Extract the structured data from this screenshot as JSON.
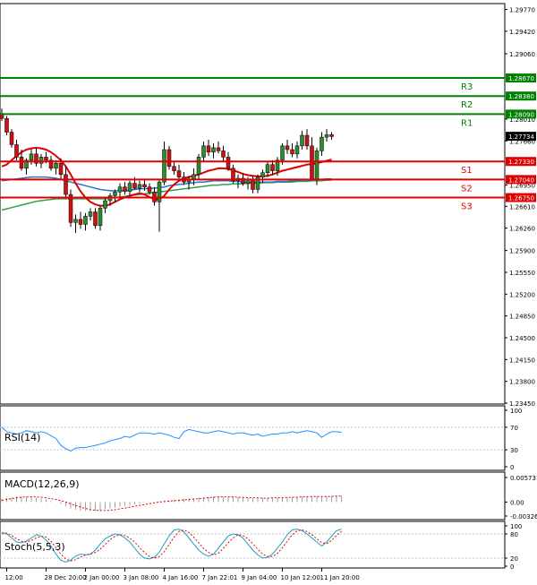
{
  "colors": {
    "background": "#ffffff",
    "frame": "#000000",
    "grid": "#c0c0c0",
    "bull": "#2e8b2e",
    "bear": "#d01010",
    "wick": "#000000",
    "ma_red": "#e00000",
    "ma_blue": "#3070d0",
    "ma_green": "#30a050",
    "resistance": "#008000",
    "support": "#e00000",
    "rsi": "#1e90ff",
    "macd_hist": "#a0a0a0",
    "macd_signal": "#e00000",
    "stoch_main": "#1aa0c0",
    "stoch_signal": "#e00000",
    "current_label_bg": "#000000",
    "current_label_fg": "#ffffff"
  },
  "price_axis": {
    "ticks": [
      "1.29770",
      "1.29420",
      "1.29060",
      "1.28010",
      "1.27660",
      "1.26950",
      "1.26610",
      "1.26260",
      "1.25900",
      "1.25550",
      "1.25200",
      "1.24850",
      "1.24500",
      "1.24150",
      "1.23800",
      "1.23450"
    ],
    "tick_values": [
      1.2977,
      1.2942,
      1.2906,
      1.2801,
      1.2766,
      1.2695,
      1.2661,
      1.2626,
      1.259,
      1.2555,
      1.252,
      1.2485,
      1.245,
      1.2415,
      1.238,
      1.2345
    ],
    "current_label": "1.27734",
    "current_value": 1.27734
  },
  "levels": [
    {
      "name": "R3",
      "price_label": "1.28670",
      "value": 1.2867,
      "kind": "resistance"
    },
    {
      "name": "R2",
      "price_label": "1.28380",
      "value": 1.2838,
      "kind": "resistance"
    },
    {
      "name": "R1",
      "price_label": "1.28090",
      "value": 1.2809,
      "kind": "resistance"
    },
    {
      "name": "S1",
      "price_label": "1.27330",
      "value": 1.2733,
      "kind": "support"
    },
    {
      "name": "S2",
      "price_label": "1.27040",
      "value": 1.2704,
      "kind": "support"
    },
    {
      "name": "S3",
      "price_label": "1.26750",
      "value": 1.2675,
      "kind": "support"
    }
  ],
  "indicators": {
    "rsi": {
      "label": "RSI(14)",
      "ticks": [
        "100",
        "70",
        "30",
        "0"
      ],
      "tick_values": [
        100,
        70,
        30,
        0
      ],
      "values": [
        70,
        62,
        60,
        58,
        60,
        64,
        62,
        60,
        62,
        60,
        55,
        50,
        38,
        32,
        28,
        33,
        34,
        34,
        36,
        38,
        40,
        42,
        46,
        48,
        50,
        54,
        52,
        56,
        60,
        60,
        59,
        58,
        60,
        58,
        56,
        52,
        50,
        62,
        66,
        64,
        62,
        60,
        60,
        62,
        64,
        62,
        60,
        58,
        60,
        60,
        58,
        56,
        58,
        54,
        56,
        58,
        58,
        60,
        60,
        62,
        60,
        62,
        64,
        62,
        60,
        52,
        58,
        62,
        62,
        61
      ]
    },
    "macd": {
      "label": "MACD(12,26,9)",
      "ticks": [
        "0.005731",
        "0.00",
        "-0.003269"
      ],
      "tick_values": [
        0.005731,
        0,
        -0.003269
      ],
      "hist": [
        0.0008,
        0.001,
        0.0012,
        0.0013,
        0.0013,
        0.0012,
        0.0011,
        0.001,
        0.0008,
        0.0006,
        0.0003,
        0,
        -0.0005,
        -0.001,
        -0.0015,
        -0.0018,
        -0.002,
        -0.0021,
        -0.0021,
        -0.002,
        -0.0019,
        -0.0017,
        -0.0015,
        -0.0013,
        -0.0011,
        -0.0009,
        -0.0007,
        -0.0005,
        -0.0003,
        -0.0001,
        0,
        0.0001,
        0.0002,
        0.0003,
        0.0004,
        0.0005,
        0.0006,
        0.0007,
        0.0008,
        0.0009,
        0.001,
        0.0011,
        0.0012,
        0.0013,
        0.0013,
        0.0012,
        0.0012,
        0.0011,
        0.0011,
        0.001,
        0.001,
        0.0009,
        0.0009,
        0.0009,
        0.001,
        0.001,
        0.001,
        0.0011,
        0.0011,
        0.0011,
        0.0012,
        0.0012,
        0.0013,
        0.0013,
        0.0013,
        0.0012,
        0.0013,
        0.0014,
        0.0015,
        0.0015
      ],
      "signal": [
        0.0004,
        0.0006,
        0.0008,
        0.001,
        0.0011,
        0.0012,
        0.0012,
        0.0012,
        0.0011,
        0.001,
        0.0008,
        0.0006,
        0.0003,
        0,
        -0.0004,
        -0.0008,
        -0.0012,
        -0.0015,
        -0.0018,
        -0.0019,
        -0.002,
        -0.002,
        -0.0019,
        -0.0018,
        -0.0016,
        -0.0014,
        -0.0012,
        -0.001,
        -0.0008,
        -0.0006,
        -0.0004,
        -0.0002,
        0,
        0.0001,
        0.0002,
        0.0003,
        0.0004,
        0.0005,
        0.0006,
        0.0007,
        0.0008,
        0.0009,
        0.001,
        0.0011,
        0.0012,
        0.0012,
        0.0012,
        0.0012,
        0.0011,
        0.0011,
        0.001,
        0.001,
        0.001,
        0.0009,
        0.0009,
        0.001,
        0.001,
        0.001,
        0.0011,
        0.0011,
        0.0011,
        0.0012,
        0.0012,
        0.0013,
        0.0013,
        0.0013,
        0.0013,
        0.0013,
        0.0014,
        0.0014
      ]
    },
    "stoch": {
      "label": "Stoch(5,5,3)",
      "ticks": [
        "100",
        "80",
        "20",
        "0"
      ],
      "tick_values": [
        100,
        80,
        20,
        0
      ],
      "main": [
        85,
        80,
        70,
        60,
        58,
        62,
        70,
        78,
        75,
        65,
        50,
        30,
        15,
        10,
        15,
        25,
        30,
        28,
        30,
        40,
        55,
        68,
        75,
        80,
        78,
        70,
        60,
        45,
        30,
        20,
        18,
        22,
        35,
        55,
        75,
        90,
        92,
        85,
        70,
        55,
        40,
        30,
        25,
        30,
        45,
        60,
        75,
        80,
        78,
        70,
        55,
        40,
        28,
        20,
        22,
        30,
        45,
        60,
        78,
        90,
        92,
        88,
        80,
        70,
        60,
        50,
        60,
        75,
        88,
        92
      ],
      "signal": [
        80,
        82,
        76,
        68,
        62,
        60,
        64,
        70,
        74,
        72,
        62,
        46,
        30,
        18,
        13,
        16,
        23,
        28,
        30,
        34,
        42,
        54,
        66,
        74,
        78,
        76,
        70,
        60,
        46,
        34,
        24,
        20,
        24,
        36,
        54,
        72,
        86,
        90,
        84,
        72,
        58,
        44,
        34,
        28,
        32,
        44,
        58,
        70,
        78,
        76,
        68,
        56,
        42,
        30,
        24,
        24,
        32,
        46,
        62,
        78,
        88,
        90,
        86,
        78,
        68,
        58,
        56,
        64,
        76,
        86
      ]
    }
  },
  "time_axis": {
    "labels": [
      "12:00",
      "28 Dec 20:00",
      "2 Jan 00:00",
      "3 Jan 08:00",
      "4 Jan 16:00",
      "7 Jan 22:01",
      "9 Jan 04:00",
      "10 Jan 12:00",
      "11 Jan 20:00"
    ],
    "label_bar_index": [
      1,
      9,
      17,
      25,
      33,
      41,
      49,
      57,
      65
    ]
  },
  "chart_data": {
    "type": "candlestick",
    "y_range": [
      1.2345,
      1.2985
    ],
    "ohlc": [
      [
        1.281,
        1.2818,
        1.2798,
        1.2802
      ],
      [
        1.2802,
        1.2806,
        1.2775,
        1.278
      ],
      [
        1.278,
        1.2785,
        1.2755,
        1.276
      ],
      [
        1.276,
        1.2768,
        1.2735,
        1.274
      ],
      [
        1.274,
        1.2752,
        1.2718,
        1.2722
      ],
      [
        1.2722,
        1.2738,
        1.2712,
        1.2735
      ],
      [
        1.2735,
        1.2752,
        1.2728,
        1.2745
      ],
      [
        1.2745,
        1.2755,
        1.2725,
        1.273
      ],
      [
        1.273,
        1.2745,
        1.2722,
        1.274
      ],
      [
        1.274,
        1.2748,
        1.273,
        1.2735
      ],
      [
        1.2735,
        1.2742,
        1.2718,
        1.2722
      ],
      [
        1.2722,
        1.2735,
        1.2712,
        1.273
      ],
      [
        1.273,
        1.2738,
        1.2705,
        1.2712
      ],
      [
        1.2712,
        1.2725,
        1.2675,
        1.268
      ],
      [
        1.268,
        1.2688,
        1.2628,
        1.2635
      ],
      [
        1.2635,
        1.2648,
        1.2618,
        1.264
      ],
      [
        1.264,
        1.2652,
        1.2625,
        1.2632
      ],
      [
        1.2632,
        1.265,
        1.2622,
        1.2645
      ],
      [
        1.2645,
        1.2658,
        1.2638,
        1.2652
      ],
      [
        1.2652,
        1.2658,
        1.2625,
        1.263
      ],
      [
        1.263,
        1.2662,
        1.2622,
        1.2658
      ],
      [
        1.2658,
        1.2675,
        1.265,
        1.267
      ],
      [
        1.267,
        1.2682,
        1.2662,
        1.2678
      ],
      [
        1.2678,
        1.2688,
        1.2668,
        1.2684
      ],
      [
        1.2684,
        1.2698,
        1.2676,
        1.2692
      ],
      [
        1.2692,
        1.27,
        1.268,
        1.2685
      ],
      [
        1.2685,
        1.2702,
        1.2678,
        1.2698
      ],
      [
        1.2698,
        1.2708,
        1.2688,
        1.269
      ],
      [
        1.269,
        1.2702,
        1.2684,
        1.2696
      ],
      [
        1.2696,
        1.2704,
        1.2686,
        1.2692
      ],
      [
        1.2692,
        1.2698,
        1.268,
        1.2684
      ],
      [
        1.2684,
        1.2692,
        1.2662,
        1.2668
      ],
      [
        1.2668,
        1.2705,
        1.262,
        1.27
      ],
      [
        1.27,
        1.2765,
        1.2695,
        1.2752
      ],
      [
        1.2752,
        1.2758,
        1.272,
        1.2725
      ],
      [
        1.2725,
        1.2732,
        1.2712,
        1.2718
      ],
      [
        1.2718,
        1.2728,
        1.2702,
        1.2708
      ],
      [
        1.2708,
        1.2716,
        1.2695,
        1.27
      ],
      [
        1.27,
        1.271,
        1.2688,
        1.2705
      ],
      [
        1.2705,
        1.2722,
        1.2695,
        1.2712
      ],
      [
        1.2712,
        1.2745,
        1.2705,
        1.274
      ],
      [
        1.274,
        1.2765,
        1.2732,
        1.2758
      ],
      [
        1.2758,
        1.2768,
        1.2742,
        1.2748
      ],
      [
        1.2748,
        1.2762,
        1.2738,
        1.2755
      ],
      [
        1.2755,
        1.2765,
        1.2746,
        1.275
      ],
      [
        1.275,
        1.2758,
        1.2732,
        1.274
      ],
      [
        1.274,
        1.2748,
        1.2718,
        1.2722
      ],
      [
        1.2722,
        1.2728,
        1.2698,
        1.2702
      ],
      [
        1.2702,
        1.2712,
        1.269,
        1.2706
      ],
      [
        1.2706,
        1.2714,
        1.2694,
        1.2698
      ],
      [
        1.2698,
        1.2708,
        1.2688,
        1.2704
      ],
      [
        1.2704,
        1.271,
        1.2682,
        1.2688
      ],
      [
        1.2688,
        1.2712,
        1.2682,
        1.2708
      ],
      [
        1.2708,
        1.272,
        1.2698,
        1.2715
      ],
      [
        1.2715,
        1.2732,
        1.2708,
        1.2728
      ],
      [
        1.2728,
        1.2735,
        1.2712,
        1.2718
      ],
      [
        1.2718,
        1.274,
        1.271,
        1.2735
      ],
      [
        1.2735,
        1.2762,
        1.2728,
        1.2758
      ],
      [
        1.2758,
        1.2768,
        1.2745,
        1.2752
      ],
      [
        1.2752,
        1.2762,
        1.274,
        1.2745
      ],
      [
        1.2745,
        1.2765,
        1.2738,
        1.2758
      ],
      [
        1.2758,
        1.2782,
        1.2752,
        1.2775
      ],
      [
        1.2775,
        1.2785,
        1.2752,
        1.2758
      ],
      [
        1.2758,
        1.2772,
        1.2702,
        1.2705
      ],
      [
        1.2705,
        1.2755,
        1.2695,
        1.275
      ],
      [
        1.275,
        1.278,
        1.2742,
        1.2772
      ],
      [
        1.2772,
        1.2785,
        1.2765,
        1.2776
      ],
      [
        1.2776,
        1.278,
        1.2768,
        1.2773
      ]
    ],
    "ma_red": [
      1.2725,
      1.2728,
      1.2735,
      1.2742,
      1.2748,
      1.2752,
      1.2754,
      1.2755,
      1.2754,
      1.2752,
      1.2748,
      1.2742,
      1.2735,
      1.2725,
      1.2712,
      1.2698,
      1.2685,
      1.2675,
      1.2668,
      1.2664,
      1.2662,
      1.2662,
      1.2664,
      1.2668,
      1.2672,
      1.2675,
      1.2678,
      1.268,
      1.2682,
      1.268,
      1.2676,
      1.2672,
      1.2672,
      1.2678,
      1.2688,
      1.2696,
      1.2702,
      1.2706,
      1.2708,
      1.271,
      1.2712,
      1.2715,
      1.2718,
      1.272,
      1.2722,
      1.2722,
      1.2721,
      1.2719,
      1.2716,
      1.2713,
      1.2711,
      1.271,
      1.2709,
      1.2709,
      1.271,
      1.2712,
      1.2715,
      1.2718,
      1.272,
      1.2722,
      1.2724,
      1.2726,
      1.2728,
      1.2729,
      1.273,
      1.2732,
      1.2734,
      1.2736
    ],
    "ma_blue": [
      1.2702,
      1.2703,
      1.2704,
      1.2705,
      1.2706,
      1.2707,
      1.2708,
      1.2708,
      1.2708,
      1.2708,
      1.2707,
      1.2706,
      1.2704,
      1.2702,
      1.27,
      1.2698,
      1.2696,
      1.2694,
      1.2692,
      1.269,
      1.2688,
      1.2687,
      1.2686,
      1.2686,
      1.2686,
      1.2686,
      1.2687,
      1.2688,
      1.2689,
      1.2689,
      1.269,
      1.269,
      1.2691,
      1.2692,
      1.2694,
      1.2695,
      1.2696,
      1.2697,
      1.2698,
      1.2699,
      1.27,
      1.27,
      1.2701,
      1.2702,
      1.2702,
      1.2702,
      1.2702,
      1.2701,
      1.2701,
      1.27,
      1.27,
      1.27,
      1.27,
      1.27,
      1.27,
      1.27,
      1.2701,
      1.2701,
      1.2701,
      1.2702,
      1.2702,
      1.2703,
      1.2703,
      1.2703,
      1.2704,
      1.2704,
      1.2705,
      1.2705
    ],
    "ma_green": [
      1.2655,
      1.2657,
      1.2659,
      1.2661,
      1.2663,
      1.2665,
      1.2667,
      1.2669,
      1.267,
      1.2671,
      1.2672,
      1.2673,
      1.2673,
      1.2673,
      1.2673,
      1.2673,
      1.2673,
      1.2673,
      1.2673,
      1.2673,
      1.2673,
      1.2673,
      1.2674,
      1.2675,
      1.2676,
      1.2677,
      1.2678,
      1.2679,
      1.268,
      1.2681,
      1.2682,
      1.2683,
      1.2684,
      1.2685,
      1.2686,
      1.2687,
      1.2688,
      1.2689,
      1.269,
      1.2691,
      1.2692,
      1.2693,
      1.2694,
      1.2695,
      1.2695,
      1.2696,
      1.2696,
      1.2697,
      1.2697,
      1.2697,
      1.2698,
      1.2698,
      1.2698,
      1.2699,
      1.2699,
      1.2699,
      1.27,
      1.27,
      1.27,
      1.27,
      1.2701,
      1.2701,
      1.2701,
      1.2702,
      1.2702,
      1.2702,
      1.2703,
      1.2703
    ]
  }
}
